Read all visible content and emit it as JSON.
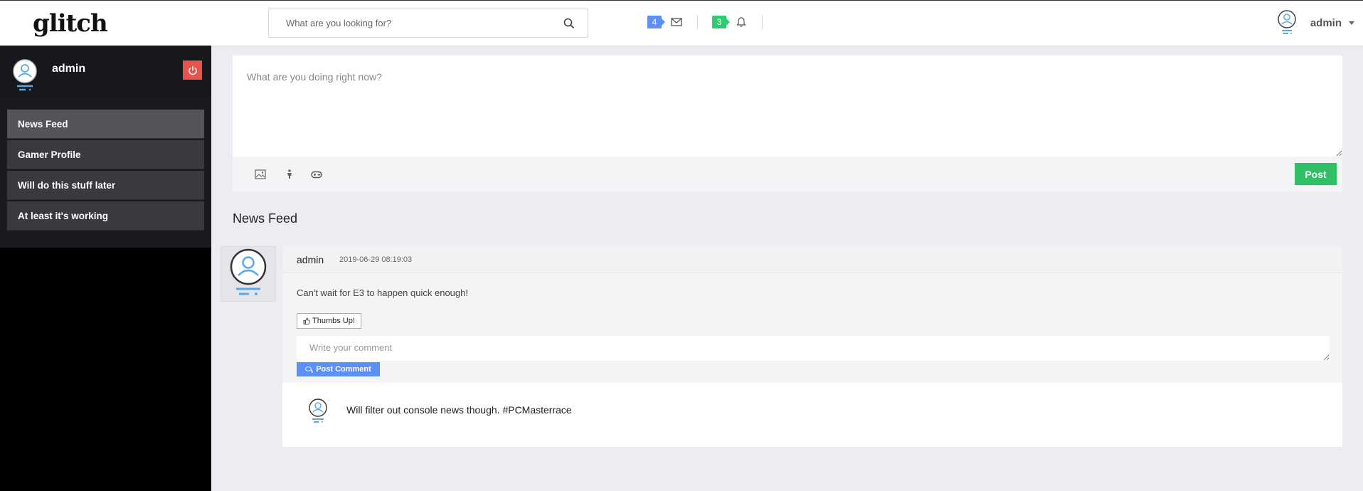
{
  "header": {
    "logo": "glitch",
    "search": {
      "placeholder": "What are you looking for?",
      "icon": "search-icon"
    },
    "messages": {
      "count": "4",
      "icon": "envelope-icon",
      "color": "#5b8ff9"
    },
    "notifications": {
      "count": "3",
      "icon": "bell-icon",
      "color": "#2ecc71"
    },
    "user": {
      "name": "admin",
      "icon": "user-avatar-icon"
    }
  },
  "sidebar": {
    "user": {
      "name": "admin"
    },
    "logout_icon": "power-icon",
    "items": [
      {
        "label": "News Feed",
        "active": true
      },
      {
        "label": "Gamer Profile"
      },
      {
        "label": "Will do this stuff later"
      },
      {
        "label": "At least it's working"
      }
    ]
  },
  "composer": {
    "placeholder": "What are you doing right now?",
    "tools": [
      "image-icon",
      "person-icon",
      "gamepad-icon"
    ],
    "post_label": "Post"
  },
  "feed": {
    "title": "News Feed",
    "posts": [
      {
        "author": "admin",
        "timestamp": "2019-06-29 08:19:03",
        "text": "Can't wait for E3 to happen quick enough!",
        "like_label": "Thumbs Up!",
        "comment_placeholder": "Write your comment",
        "comment_button": "Post Comment",
        "comments": [
          {
            "text": "Will filter out console news though. #PCMasterrace"
          }
        ]
      }
    ]
  },
  "colors": {
    "accent": "#5b8ff9",
    "success": "#2fbf65",
    "danger": "#e8544b",
    "sidebar": "#000000"
  }
}
